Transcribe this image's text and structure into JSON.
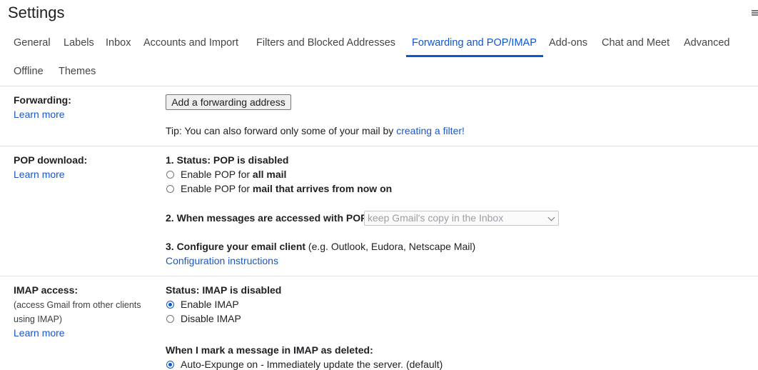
{
  "header": {
    "title": "Settings"
  },
  "tabs": [
    {
      "label": "General"
    },
    {
      "label": "Labels"
    },
    {
      "label": "Inbox"
    },
    {
      "label": "Accounts and Import"
    },
    {
      "label": "Filters and Blocked Addresses"
    },
    {
      "label": "Forwarding and POP/IMAP"
    },
    {
      "label": "Add-ons"
    },
    {
      "label": "Chat and Meet"
    },
    {
      "label": "Advanced"
    },
    {
      "label": "Offline"
    },
    {
      "label": "Themes"
    }
  ],
  "active_tab": "Forwarding and POP/IMAP",
  "forwarding": {
    "label": "Forwarding:",
    "learn_more": "Learn more",
    "add_button": "Add a forwarding address",
    "tip_prefix": "Tip: You can also forward only some of your mail by ",
    "tip_link": "creating a filter!"
  },
  "pop": {
    "label": "POP download:",
    "learn_more": "Learn more",
    "status": "1. Status: POP is disabled",
    "option1_prefix": "Enable POP for ",
    "option1_bold": "all mail",
    "option2_prefix": "Enable POP for ",
    "option2_bold": "mail that arrives from now on",
    "accessed_label": "2. When messages are accessed with POP",
    "accessed_select": "keep Gmail's copy in the Inbox",
    "configure_bold": "3. Configure your email client",
    "configure_rest": " (e.g. Outlook, Eudora, Netscape Mail)",
    "config_link": "Configuration instructions"
  },
  "imap": {
    "label": "IMAP access:",
    "sub1": "(access Gmail from other clients",
    "sub2": "using IMAP)",
    "learn_more": "Learn more",
    "status": "Status: IMAP is disabled",
    "enable": "Enable IMAP",
    "disable": "Disable IMAP",
    "deleted_heading": "When I mark a message in IMAP as deleted:",
    "auto_expunge": "Auto-Expunge on - Immediately update the server. (default)"
  },
  "colors": {
    "accent": "#0b57d0",
    "link": "#1a56c8",
    "divider": "#e0e0e0"
  }
}
